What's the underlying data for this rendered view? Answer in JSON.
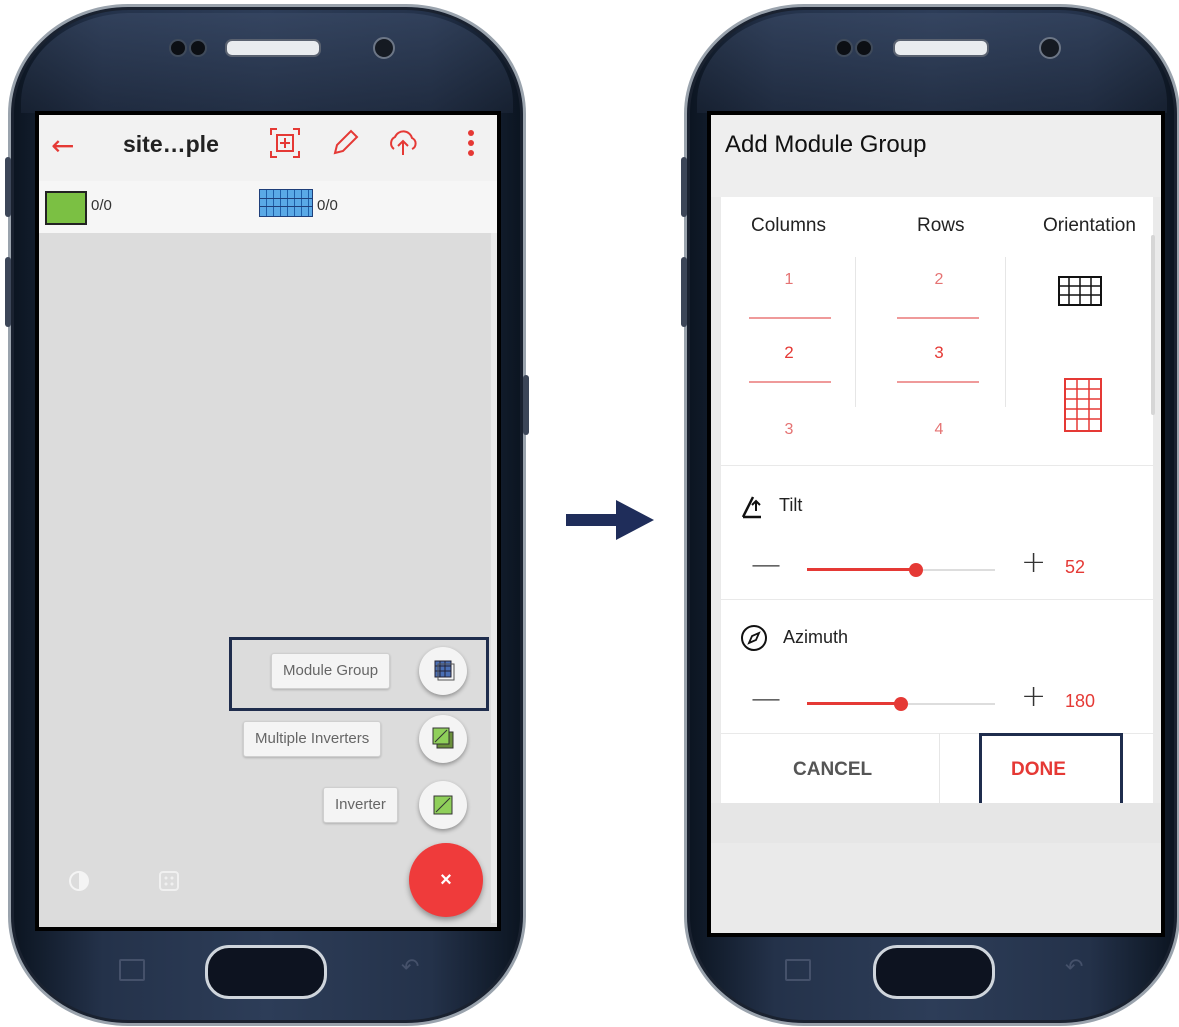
{
  "left_screen": {
    "title": "site…ple",
    "inverter_count": "0/0",
    "module_count": "0/0",
    "fab_items": [
      {
        "label": "Module Group",
        "icon": "module-group-icon"
      },
      {
        "label": "Multiple Inverters",
        "icon": "multiple-inverters-icon"
      },
      {
        "label": "Inverter",
        "icon": "inverter-icon"
      }
    ],
    "fab_close": "×",
    "icons": [
      "back-arrow-icon",
      "scan-icon",
      "pencil-icon",
      "cloud-upload-icon",
      "more-vert-icon"
    ]
  },
  "right_screen": {
    "dialog_title": "Add Module Group",
    "columns_label": "Columns",
    "rows_label": "Rows",
    "orientation_label": "Orientation",
    "columns_values": [
      "1",
      "2",
      "3"
    ],
    "columns_selected": "2",
    "rows_values": [
      "2",
      "3",
      "4"
    ],
    "rows_selected": "3",
    "tilt_label": "Tilt",
    "tilt_value": "52",
    "tilt_slider_max": 90,
    "azimuth_label": "Azimuth",
    "azimuth_value": "180",
    "azimuth_slider_max": 360,
    "cancel_label": "CANCEL",
    "done_label": "DONE"
  },
  "colors": {
    "accent": "#e53935",
    "highlight_border": "#1f2d4d",
    "arrow": "#1f2d5a"
  }
}
